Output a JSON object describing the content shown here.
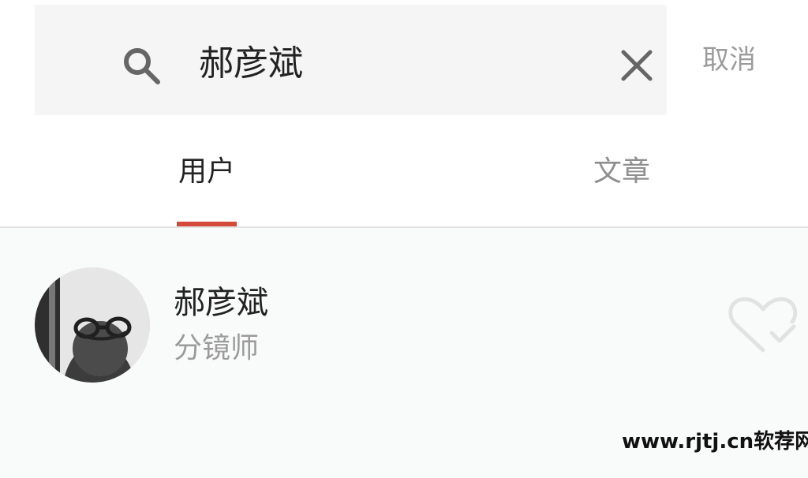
{
  "search": {
    "query": "郝彦斌",
    "cancel_label": "取消"
  },
  "tabs": [
    {
      "label": "用户",
      "active": true
    },
    {
      "label": "文章",
      "active": false
    }
  ],
  "results": [
    {
      "name": "郝彦斌",
      "role": "分镜师",
      "follow_icon": "heart-check-icon"
    }
  ],
  "watermark": "www.rjtj.cn软荐网",
  "colors": {
    "accent": "#d44a3a",
    "search_bg": "#f5f5f5",
    "list_bg": "#f9fbfa",
    "muted_text": "#9b9b9b",
    "primary_text": "#222222"
  },
  "icons": {
    "search": "search-icon",
    "clear": "close-icon",
    "follow": "heart-check-icon"
  }
}
